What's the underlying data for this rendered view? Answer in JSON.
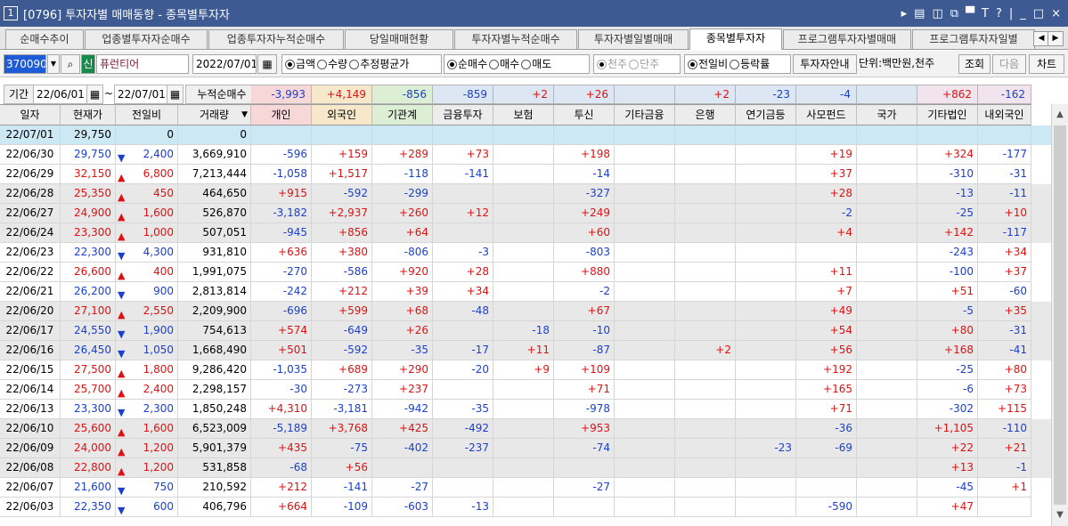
{
  "window": {
    "screen_no": "1",
    "title": "[0796] 투자자별 매매동향 - 종목별투자자",
    "controls": [
      "▸",
      "▤",
      "◫",
      "⧉",
      "▀",
      "T",
      "?",
      "|",
      "_",
      "□",
      "×"
    ]
  },
  "tabs": [
    {
      "label": "순매수추이",
      "active": false
    },
    {
      "label": "업종별투자자순매수",
      "active": false
    },
    {
      "label": "업종투자자누적순매수",
      "active": false
    },
    {
      "label": "당일매매현황",
      "active": false
    },
    {
      "label": "투자자별누적순매수",
      "active": false
    },
    {
      "label": "투자자별일별매매",
      "active": false
    },
    {
      "label": "종목별투자자",
      "active": true
    },
    {
      "label": "프로그램투자자별매매",
      "active": false
    },
    {
      "label": "프로그램투자자일별",
      "active": false
    }
  ],
  "toolbar": {
    "stock_code": "370090",
    "credit_badge": "신",
    "stock_name": "퓨런티어",
    "date": "2022/07/01",
    "unit_group": [
      {
        "label": "금액",
        "checked": true
      },
      {
        "label": "수량",
        "checked": false
      },
      {
        "label": "추정평균가",
        "checked": false
      }
    ],
    "trade_group": [
      {
        "label": "순매수",
        "checked": true
      },
      {
        "label": "매수",
        "checked": false
      },
      {
        "label": "매도",
        "checked": false
      }
    ],
    "share_group": [
      {
        "label": "천주",
        "checked": true
      },
      {
        "label": "단주",
        "checked": false
      }
    ],
    "ratio_group": [
      {
        "label": "전일비",
        "checked": true
      },
      {
        "label": "등락률",
        "checked": false
      }
    ],
    "guide_button": "투자자안내",
    "unit_text": "단위:백만원,천주",
    "query_button": "조회",
    "next_button": "다음",
    "chart_button": "차트"
  },
  "period": {
    "label": "기간",
    "from": "22/06/01",
    "to": "22/07/01",
    "cumulative_label": "누적순매수",
    "sums": [
      "-3,993",
      "+4,149",
      "-856",
      "-859",
      "+2",
      "+26",
      "",
      "+2",
      "-23",
      "-4",
      "",
      "+862",
      "-162"
    ]
  },
  "columns": [
    "일자",
    "현재가",
    "전일비",
    "거래량",
    "개인",
    "외국인",
    "기관계",
    "금융투자",
    "보험",
    "투신",
    "기타금융",
    "은행",
    "연기금등",
    "사모펀드",
    "국가",
    "기타법인",
    "내외국인"
  ],
  "rows": [
    {
      "date": "22/07/01",
      "price": "29,750",
      "dir": "",
      "change": "0",
      "volume": "0",
      "vals": [
        "",
        "",
        "",
        "",
        "",
        "",
        "",
        "",
        "",
        "",
        "",
        "",
        ""
      ]
    },
    {
      "date": "22/06/30",
      "price": "29,750",
      "dir": "down",
      "change": "2,400",
      "volume": "3,669,910",
      "vals": [
        "-596",
        "+159",
        "+289",
        "+73",
        "",
        "+198",
        "",
        "",
        "",
        "+19",
        "",
        "+324",
        "-177"
      ]
    },
    {
      "date": "22/06/29",
      "price": "32,150",
      "dir": "up",
      "change": "6,800",
      "volume": "7,213,444",
      "vals": [
        "-1,058",
        "+1,517",
        "-118",
        "-141",
        "",
        "-14",
        "",
        "",
        "",
        "+37",
        "",
        "-310",
        "-31"
      ]
    },
    {
      "date": "22/06/28",
      "price": "25,350",
      "dir": "up",
      "change": "450",
      "volume": "464,650",
      "vals": [
        "+915",
        "-592",
        "-299",
        "",
        "",
        "-327",
        "",
        "",
        "",
        "+28",
        "",
        "-13",
        "-11"
      ]
    },
    {
      "date": "22/06/27",
      "price": "24,900",
      "dir": "up",
      "change": "1,600",
      "volume": "526,870",
      "vals": [
        "-3,182",
        "+2,937",
        "+260",
        "+12",
        "",
        "+249",
        "",
        "",
        "",
        "-2",
        "",
        "-25",
        "+10"
      ]
    },
    {
      "date": "22/06/24",
      "price": "23,300",
      "dir": "up",
      "change": "1,000",
      "volume": "507,051",
      "vals": [
        "-945",
        "+856",
        "+64",
        "",
        "",
        "+60",
        "",
        "",
        "",
        "+4",
        "",
        "+142",
        "-117"
      ]
    },
    {
      "date": "22/06/23",
      "price": "22,300",
      "dir": "down",
      "change": "4,300",
      "volume": "931,810",
      "vals": [
        "+636",
        "+380",
        "-806",
        "-3",
        "",
        "-803",
        "",
        "",
        "",
        "",
        "",
        "-243",
        "+34"
      ]
    },
    {
      "date": "22/06/22",
      "price": "26,600",
      "dir": "up",
      "change": "400",
      "volume": "1,991,075",
      "vals": [
        "-270",
        "-586",
        "+920",
        "+28",
        "",
        "+880",
        "",
        "",
        "",
        "+11",
        "",
        "-100",
        "+37"
      ]
    },
    {
      "date": "22/06/21",
      "price": "26,200",
      "dir": "down",
      "change": "900",
      "volume": "2,813,814",
      "vals": [
        "-242",
        "+212",
        "+39",
        "+34",
        "",
        "-2",
        "",
        "",
        "",
        "+7",
        "",
        "+51",
        "-60"
      ]
    },
    {
      "date": "22/06/20",
      "price": "27,100",
      "dir": "up",
      "change": "2,550",
      "volume": "2,209,900",
      "vals": [
        "-696",
        "+599",
        "+68",
        "-48",
        "",
        "+67",
        "",
        "",
        "",
        "+49",
        "",
        "-5",
        "+35"
      ]
    },
    {
      "date": "22/06/17",
      "price": "24,550",
      "dir": "down",
      "change": "1,900",
      "volume": "754,613",
      "vals": [
        "+574",
        "-649",
        "+26",
        "",
        "-18",
        "-10",
        "",
        "",
        "",
        "+54",
        "",
        "+80",
        "-31"
      ]
    },
    {
      "date": "22/06/16",
      "price": "26,450",
      "dir": "down",
      "change": "1,050",
      "volume": "1,668,490",
      "vals": [
        "+501",
        "-592",
        "-35",
        "-17",
        "+11",
        "-87",
        "",
        "+2",
        "",
        "+56",
        "",
        "+168",
        "-41"
      ]
    },
    {
      "date": "22/06/15",
      "price": "27,500",
      "dir": "up",
      "change": "1,800",
      "volume": "9,286,420",
      "vals": [
        "-1,035",
        "+689",
        "+290",
        "-20",
        "+9",
        "+109",
        "",
        "",
        "",
        "+192",
        "",
        "-25",
        "+80"
      ]
    },
    {
      "date": "22/06/14",
      "price": "25,700",
      "dir": "up",
      "change": "2,400",
      "volume": "2,298,157",
      "vals": [
        "-30",
        "-273",
        "+237",
        "",
        "",
        "+71",
        "",
        "",
        "",
        "+165",
        "",
        "-6",
        "+73"
      ]
    },
    {
      "date": "22/06/13",
      "price": "23,300",
      "dir": "down",
      "change": "2,300",
      "volume": "1,850,248",
      "vals": [
        "+4,310",
        "-3,181",
        "-942",
        "-35",
        "",
        "-978",
        "",
        "",
        "",
        "+71",
        "",
        "-302",
        "+115"
      ]
    },
    {
      "date": "22/06/10",
      "price": "25,600",
      "dir": "up",
      "change": "1,600",
      "volume": "6,523,009",
      "vals": [
        "-5,189",
        "+3,768",
        "+425",
        "-492",
        "",
        "+953",
        "",
        "",
        "",
        "-36",
        "",
        "+1,105",
        "-110"
      ]
    },
    {
      "date": "22/06/09",
      "price": "24,000",
      "dir": "up",
      "change": "1,200",
      "volume": "5,901,379",
      "vals": [
        "+435",
        "-75",
        "-402",
        "-237",
        "",
        "-74",
        "",
        "",
        "-23",
        "-69",
        "",
        "+22",
        "+21"
      ]
    },
    {
      "date": "22/06/08",
      "price": "22,800",
      "dir": "up",
      "change": "1,200",
      "volume": "531,858",
      "vals": [
        "-68",
        "+56",
        "",
        "",
        "",
        "",
        "",
        "",
        "",
        "",
        "",
        "+13",
        "-1"
      ]
    },
    {
      "date": "22/06/07",
      "price": "21,600",
      "dir": "down",
      "change": "750",
      "volume": "210,592",
      "vals": [
        "+212",
        "-141",
        "-27",
        "",
        "",
        "-27",
        "",
        "",
        "",
        "",
        "",
        "-45",
        "+1"
      ]
    },
    {
      "date": "22/06/03",
      "price": "22,350",
      "dir": "down",
      "change": "600",
      "volume": "406,796",
      "vals": [
        "+664",
        "-109",
        "-603",
        "-13",
        "",
        "",
        "",
        "",
        "",
        "-590",
        "",
        "+47",
        ""
      ]
    }
  ],
  "colors": {
    "title_bar": "#3d5a93",
    "up": "#e01010",
    "down": "#1a40d0",
    "selected_row": "#cce8f4",
    "alt_row": "#e8e8e8"
  }
}
